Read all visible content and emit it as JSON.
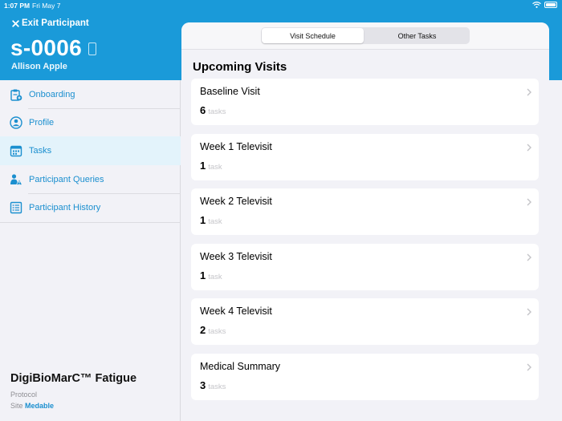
{
  "status_bar": {
    "time": "1:07 PM",
    "date": "Fri May 7"
  },
  "header": {
    "exit_label": "Exit Participant",
    "participant_id": "s-0006",
    "participant_name": "Allison Apple"
  },
  "sidebar": {
    "items": [
      {
        "label": "Onboarding",
        "icon": "clipboard-plus-icon"
      },
      {
        "label": "Profile",
        "icon": "person-circle-icon"
      },
      {
        "label": "Tasks",
        "icon": "calendar-icon",
        "active": true
      },
      {
        "label": "Participant Queries",
        "icon": "person-alert-icon"
      },
      {
        "label": "Participant History",
        "icon": "list-icon"
      }
    ],
    "study_name": "DigiBioMarC™ Fatigue",
    "protocol_label": "Protocol",
    "site_label": "Site",
    "site_value": "Medable"
  },
  "main": {
    "segments": [
      {
        "label": "Visit Schedule",
        "selected": true
      },
      {
        "label": "Other Tasks",
        "selected": false
      }
    ],
    "section_title": "Upcoming Visits",
    "visits": [
      {
        "name": "Baseline Visit",
        "count": "6",
        "unit": "tasks"
      },
      {
        "name": "Week 1 Televisit",
        "count": "1",
        "unit": "task"
      },
      {
        "name": "Week 2 Televisit",
        "count": "1",
        "unit": "task"
      },
      {
        "name": "Week 3 Televisit",
        "count": "1",
        "unit": "task"
      },
      {
        "name": "Week 4 Televisit",
        "count": "2",
        "unit": "tasks"
      },
      {
        "name": "Medical Summary",
        "count": "3",
        "unit": "tasks"
      }
    ]
  },
  "colors": {
    "header_blue": "#1a9ad9",
    "link_blue": "#1b8fcf",
    "active_bg": "#e3f3fb",
    "background": "#f2f2f7"
  }
}
